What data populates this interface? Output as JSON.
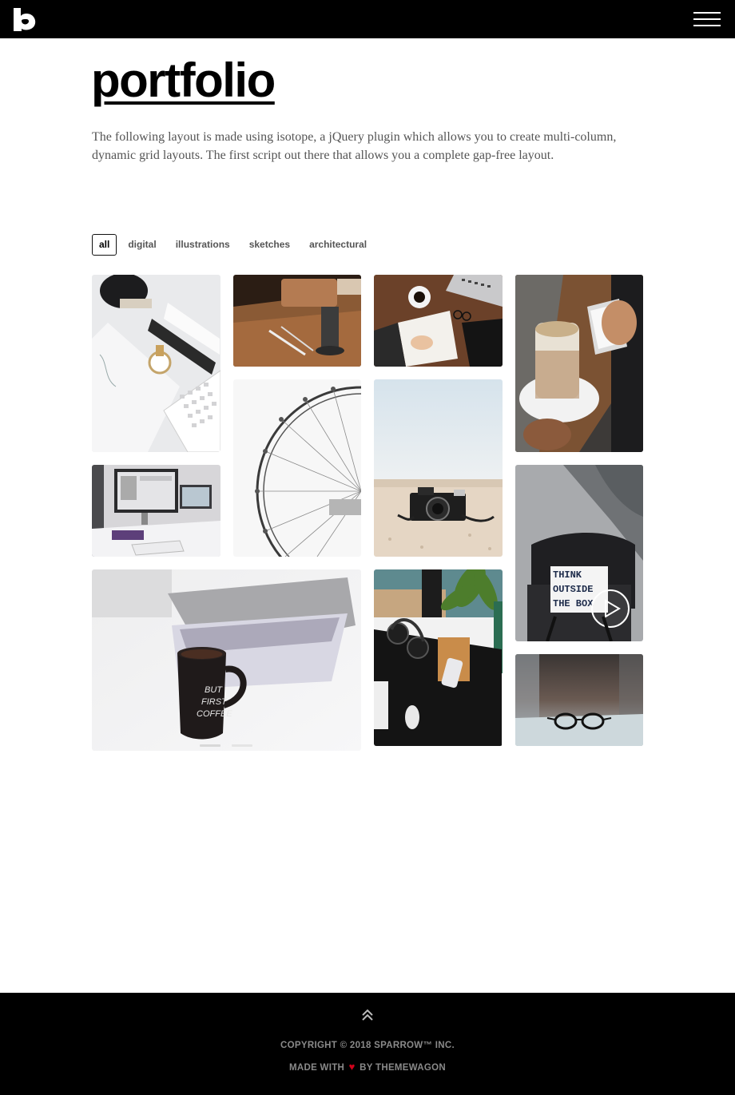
{
  "header": {
    "logo_icon": "sparrow-s-logo-icon",
    "menu_icon": "hamburger-menu-icon"
  },
  "page": {
    "title": "portfolio",
    "intro": "The following layout is made using isotope, a jQuery plugin which allows you to create multi-column, dynamic grid layouts. The first script out there that allows you a complete gap-free layout."
  },
  "filters": [
    {
      "label": "all",
      "active": true
    },
    {
      "label": "digital",
      "active": false
    },
    {
      "label": "illustrations",
      "active": false
    },
    {
      "label": "sketches",
      "active": false
    },
    {
      "label": "architectural",
      "active": false
    }
  ],
  "tiles": [
    {
      "subject": "desk-watch-keyboard-photo"
    },
    {
      "subject": "wooden-desk-tools-photo"
    },
    {
      "subject": "notebook-coffee-laptop-photo"
    },
    {
      "subject": "coffee-phone-hand-photo"
    },
    {
      "subject": "ferris-wheel-photo"
    },
    {
      "subject": "camera-on-sand-photo"
    },
    {
      "subject": "computer-desk-photo"
    },
    {
      "subject": "think-outside-the-box-lightbox-photo",
      "sign_text": [
        "THINK",
        "OUTSIDE",
        "THE BOX"
      ]
    },
    {
      "subject": "mug-and-laptop-slider-photo",
      "mug_text": [
        "BUT",
        "FIRST",
        "COFFEE"
      ]
    },
    {
      "subject": "headphones-desk-photo"
    },
    {
      "subject": "glasses-on-table-photo"
    }
  ],
  "colors": {
    "topbar": "#000000",
    "footer": "#000000",
    "heart": "#d0021b",
    "footer_text": "#8a8a8a"
  },
  "footer": {
    "to_top_icon": "double-chevron-up-icon",
    "copyright": "COPYRIGHT © 2018 SPARROW™ INC.",
    "made_with_prefix": "MADE WITH",
    "heart_icon": "heart-icon",
    "heart_glyph": "♥",
    "made_with_suffix": "BY THEMEWAGON"
  }
}
